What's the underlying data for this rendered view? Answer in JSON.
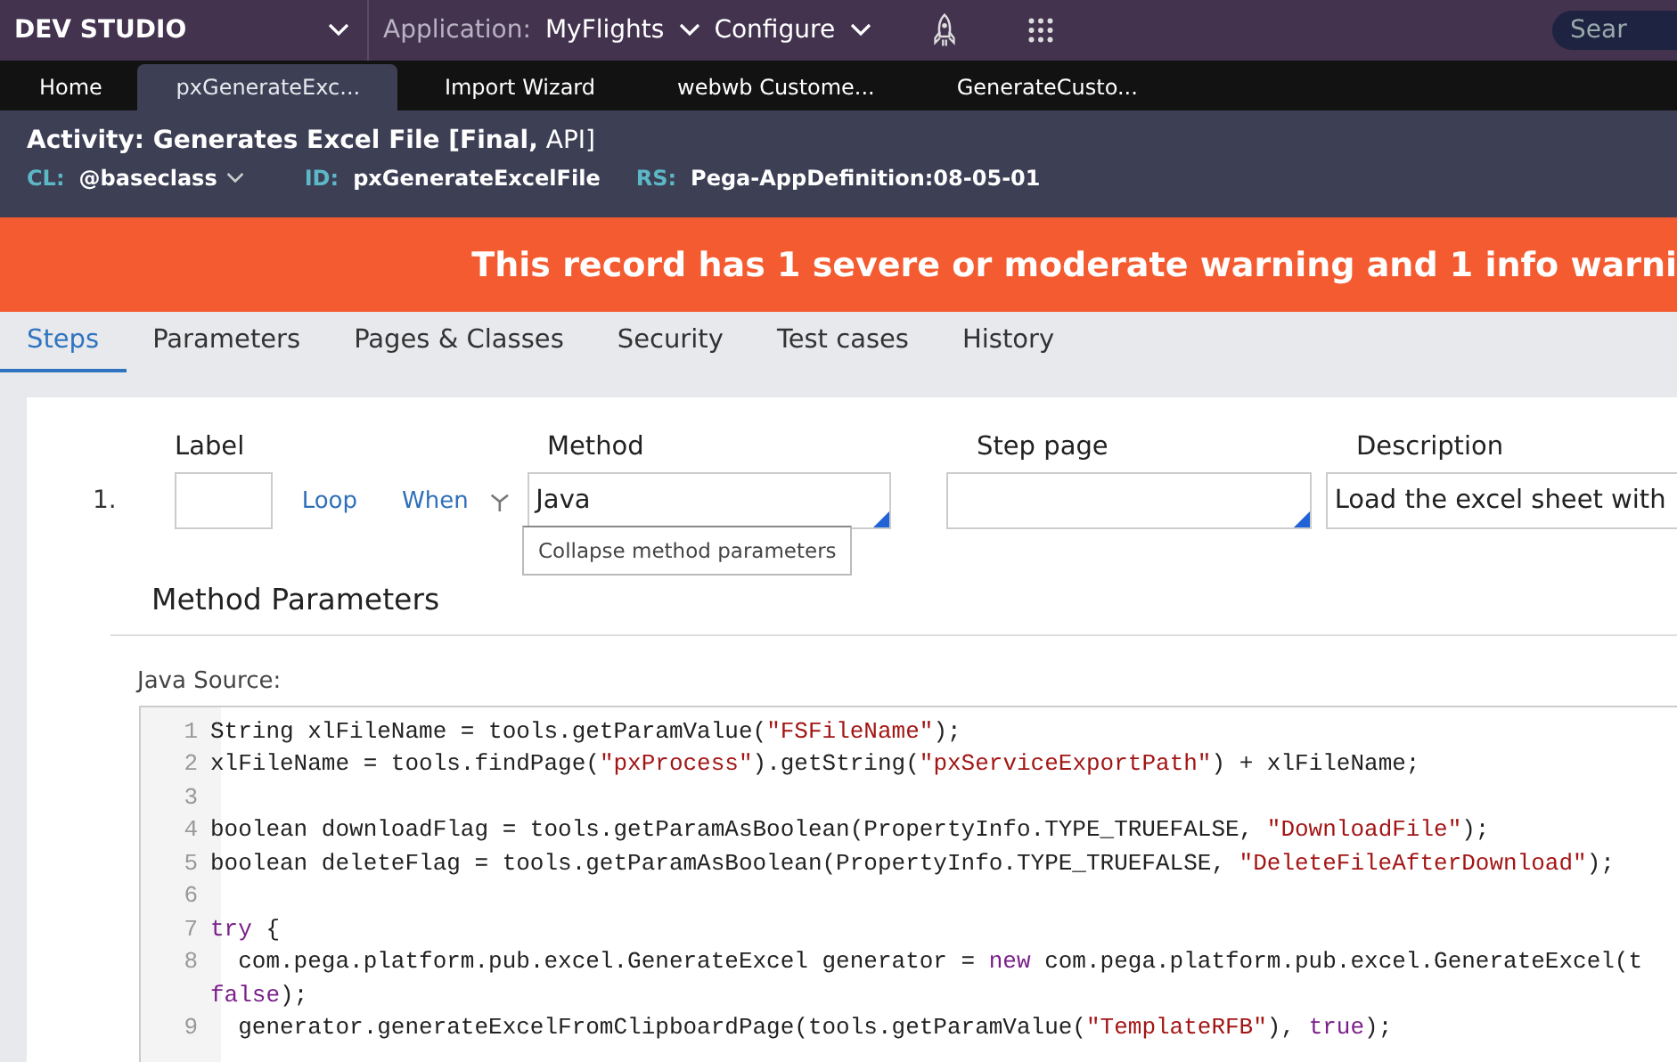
{
  "top_bar": {
    "brand": "DEV STUDIO",
    "application_label": "Application:",
    "application": "MyFlights",
    "configure": "Configure",
    "search": {
      "placeholder": "Sear"
    }
  },
  "doc_tabs": [
    {
      "label": "Home",
      "selected": false
    },
    {
      "label": "pxGenerateExc...",
      "selected": true
    },
    {
      "label": "Import Wizard",
      "selected": false
    },
    {
      "label": "webwb Custome...",
      "selected": false
    },
    {
      "label": "GenerateCusto...",
      "selected": false
    }
  ],
  "header": {
    "title": "**Activity: Generates Excel File [Final,** API]",
    "meta": [
      {
        "key": "CL:",
        "value": "@baseclass",
        "dropdown": true
      },
      {
        "key": "ID:",
        "value": "pxGenerateExcelFile",
        "dropdown": false
      },
      {
        "key": "RS:",
        "value": "Pega-AppDefinition:08-05-01",
        "dropdown": false
      }
    ]
  },
  "banner": "This record has 1 severe or moderate warning and 1 info warni",
  "rule_tabs": [
    {
      "label": "Steps",
      "selected": true
    },
    {
      "label": "Parameters",
      "selected": false
    },
    {
      "label": "Pages & Classes",
      "selected": false
    },
    {
      "label": "Security",
      "selected": false
    },
    {
      "label": "Test cases",
      "selected": false
    },
    {
      "label": "History",
      "selected": false
    }
  ],
  "columns": {
    "label": "Label",
    "method": "Method",
    "step_page": "Step page",
    "description": "Description"
  },
  "step": {
    "number": "1.",
    "loop": "Loop",
    "when": "When",
    "method": "Java",
    "description": "Load the excel sheet with",
    "tooltip": "Collapse method parameters"
  },
  "method_parameters": {
    "title": "Method Parameters",
    "source_label": "Java Source:",
    "lines": [
      {
        "number": "1",
        "tokens": [
          {
            "kind": "plain",
            "text": "String xlFileName = tools.getParamValue("
          },
          {
            "kind": "string",
            "text": "\"FSFileName\""
          },
          {
            "kind": "plain",
            "text": ");"
          }
        ]
      },
      {
        "number": "2",
        "tokens": [
          {
            "kind": "plain",
            "text": "xlFileName = tools.findPage("
          },
          {
            "kind": "string",
            "text": "\"pxProcess\""
          },
          {
            "kind": "plain",
            "text": ").getString("
          },
          {
            "kind": "string",
            "text": "\"pxServiceExportPath\""
          },
          {
            "kind": "plain",
            "text": ") + xlFileName;"
          }
        ]
      },
      {
        "number": "3"
      },
      {
        "number": "4",
        "tokens": [
          {
            "kind": "plain",
            "text": "boolean downloadFlag = tools.getParamAsBoolean(PropertyInfo.TYPE_TRUEFALSE, "
          },
          {
            "kind": "string",
            "text": "\"DownloadFile\""
          },
          {
            "kind": "plain",
            "text": ");"
          }
        ]
      },
      {
        "number": "5",
        "tokens": [
          {
            "kind": "plain",
            "text": "boolean deleteFlag = tools.getParamAsBoolean(PropertyInfo.TYPE_TRUEFALSE, "
          },
          {
            "kind": "string",
            "text": "\"DeleteFileAfterDownload\""
          },
          {
            "kind": "plain",
            "text": ");"
          }
        ]
      },
      {
        "number": "6"
      },
      {
        "number": "7",
        "tokens": [
          {
            "kind": "keyword",
            "text": "try"
          },
          {
            "kind": "plain",
            "text": " {"
          }
        ]
      },
      {
        "number": "8",
        "tokens": [
          {
            "kind": "plain",
            "text": "  com.pega.platform.pub.excel.GenerateExcel generator = "
          },
          {
            "kind": "keyword",
            "text": "new"
          },
          {
            "kind": "plain",
            "text": " com.pega.platform.pub.excel.GenerateExcel(t"
          }
        ]
      },
      {
        "tokens": [
          {
            "kind": "keyword",
            "text": "false"
          },
          {
            "kind": "plain",
            "text": ");"
          }
        ]
      },
      {
        "number": "9",
        "tokens": [
          {
            "kind": "plain",
            "text": "  generator.generateExcelFromClipboardPage(tools.getParamValue("
          },
          {
            "kind": "string",
            "text": "\"TemplateRFB\""
          },
          {
            "kind": "plain",
            "text": "), "
          },
          {
            "kind": "keyword",
            "text": "true"
          },
          {
            "kind": "plain",
            "text": ");"
          }
        ]
      }
    ]
  }
}
